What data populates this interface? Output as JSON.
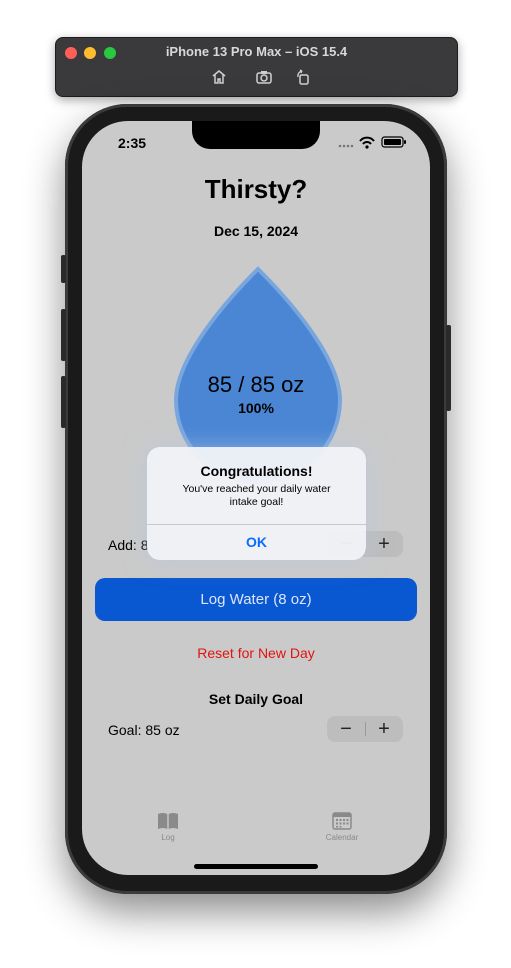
{
  "simulator": {
    "title": "iPhone 13 Pro Max – iOS 15.4",
    "toolbar_icons": [
      "home-icon",
      "screenshot-icon",
      "rotate-icon"
    ]
  },
  "status_bar": {
    "time": "2:35",
    "icons": [
      "cellular-icon",
      "wifi-icon",
      "battery-icon"
    ]
  },
  "app": {
    "title": "Thirsty?",
    "date": "Dec 15, 2024",
    "progress": {
      "amount_text": "85 / 85 oz",
      "percent_text": "100%",
      "fraction": 1.0
    },
    "add": {
      "label": "Add: 8",
      "minus": "−",
      "plus": "+"
    },
    "log_button": "Log Water (8 oz)",
    "reset_button": "Reset for New Day",
    "goal": {
      "heading": "Set Daily Goal",
      "label": "Goal: 85 oz",
      "minus": "−",
      "plus": "+"
    }
  },
  "tabbar": {
    "tabs": [
      {
        "label": "Log",
        "icon": "book-icon"
      },
      {
        "label": "Calendar",
        "icon": "calendar-icon"
      }
    ]
  },
  "alert": {
    "title": "Congratulations!",
    "message": "You've reached your daily water intake goal!",
    "ok": "OK"
  },
  "colors": {
    "accent": "#0a57d2",
    "drop_fill": "#4a86d4",
    "reset_red": "#e3130f",
    "alert_button": "#0a6cff"
  }
}
